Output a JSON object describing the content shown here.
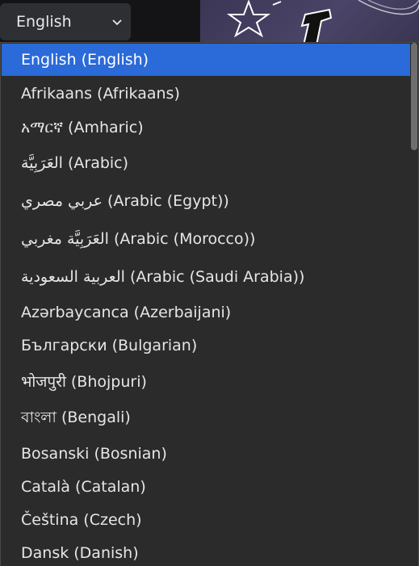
{
  "language_select": {
    "value": "English",
    "options": [
      "English (English)",
      "Afrikaans (Afrikaans)",
      "አማርኛ (Amharic)",
      "العَرَبِيَّة (Arabic)",
      "عربي مصري (Arabic (Egypt))",
      "العَرَبِيَّة مغربي (Arabic (Morocco))",
      "العربية السعودية (Arabic (Saudi Arabia))",
      "Azərbaycanca (Azerbaijani)",
      "Български (Bulgarian)",
      "भोजपुरी (Bhojpuri)",
      "বাংলা (Bengali)",
      "Bosanski (Bosnian)",
      "Català (Catalan)",
      "Čeština (Czech)",
      "Dansk (Danish)"
    ],
    "selected_index": 0
  },
  "colors": {
    "selected_background": "#2a6ad9",
    "dropdown_background": "#2b2b2b",
    "text": "#e6e6e6"
  },
  "icons": {
    "select_arrow": "chevron-down-icon",
    "banner_art": "star-doodle-icon"
  }
}
